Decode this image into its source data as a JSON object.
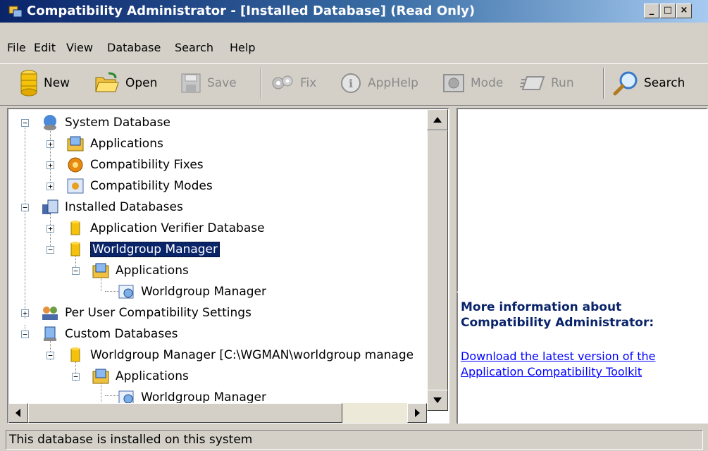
{
  "window": {
    "title": "Compatibility Administrator - [Installed Database] (Read Only)",
    "controls": {
      "minimize": "_",
      "maximize": "□",
      "close": "×"
    }
  },
  "menu": [
    "File",
    "Edit",
    "View",
    "Database",
    "Search",
    "Help"
  ],
  "toolbar": {
    "new": "New",
    "open": "Open",
    "save": "Save",
    "fix": "Fix",
    "apphelp": "AppHelp",
    "mode": "Mode",
    "run": "Run",
    "search": "Search"
  },
  "tree": [
    {
      "label": "System Database",
      "icon": "system-database-icon",
      "expander": "−"
    },
    {
      "label": "Applications",
      "icon": "applications-folder-icon",
      "expander": "+"
    },
    {
      "label": "Compatibility Fixes",
      "icon": "compatibility-fixes-icon",
      "expander": "+"
    },
    {
      "label": "Compatibility Modes",
      "icon": "compatibility-modes-icon",
      "expander": "+"
    },
    {
      "label": "Installed Databases",
      "icon": "installed-databases-icon",
      "expander": "−"
    },
    {
      "label": "Application Verifier Database",
      "icon": "database-icon",
      "expander": "+"
    },
    {
      "label": "Worldgroup Manager",
      "icon": "database-icon",
      "expander": "−",
      "selected": true
    },
    {
      "label": "Applications",
      "icon": "applications-folder-icon",
      "expander": "−"
    },
    {
      "label": "Worldgroup Manager",
      "icon": "application-icon"
    },
    {
      "label": "Per User Compatibility Settings",
      "icon": "users-icon",
      "expander": "+"
    },
    {
      "label": "Custom Databases",
      "icon": "custom-databases-icon",
      "expander": "−"
    },
    {
      "label": "Worldgroup Manager [C:\\WGMAN\\worldgroup manage",
      "icon": "database-icon",
      "expander": "−"
    },
    {
      "label": "Applications",
      "icon": "applications-folder-icon",
      "expander": "−"
    },
    {
      "label": "Worldgroup Manager",
      "icon": "application-icon"
    }
  ],
  "info": {
    "title_line1": "More information about",
    "title_line2": "Compatibility Administrator:",
    "link_line1": "Download the latest version of the",
    "link_line2": "Application Compatibility Toolkit"
  },
  "status": "This database is installed on this system"
}
